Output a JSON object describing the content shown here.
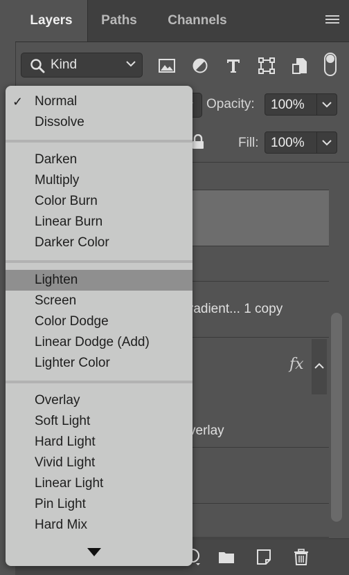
{
  "tabs": [
    {
      "label": "Layers",
      "active": true
    },
    {
      "label": "Paths",
      "active": false
    },
    {
      "label": "Channels",
      "active": false
    }
  ],
  "filter": {
    "kind_label": "Kind",
    "icons": [
      "image-filter-icon",
      "adjustment-filter-icon",
      "type-filter-icon",
      "shape-filter-icon",
      "smart-object-filter-icon",
      "filter-toggle"
    ]
  },
  "opacity": {
    "label": "Opacity:",
    "value": "100%"
  },
  "fill": {
    "label": "Fill:",
    "value": "100%"
  },
  "layers": {
    "gradient_name_fragment": "radient... 1 copy",
    "overlay_fragment": "verlay",
    "fx_label": "fx"
  },
  "blend_menu": {
    "selected": "Normal",
    "highlighted": "Lighten",
    "groups": [
      [
        "Normal",
        "Dissolve"
      ],
      [
        "Darken",
        "Multiply",
        "Color Burn",
        "Linear Burn",
        "Darker Color"
      ],
      [
        "Lighten",
        "Screen",
        "Color Dodge",
        "Linear Dodge (Add)",
        "Lighter Color"
      ],
      [
        "Overlay",
        "Soft Light",
        "Hard Light",
        "Vivid Light",
        "Linear Light",
        "Pin Light",
        "Hard Mix"
      ]
    ]
  },
  "colors": {
    "panel_bg": "#535353",
    "menu_bg": "#c8c9c8",
    "menu_highlight": "#8f8f8f"
  }
}
